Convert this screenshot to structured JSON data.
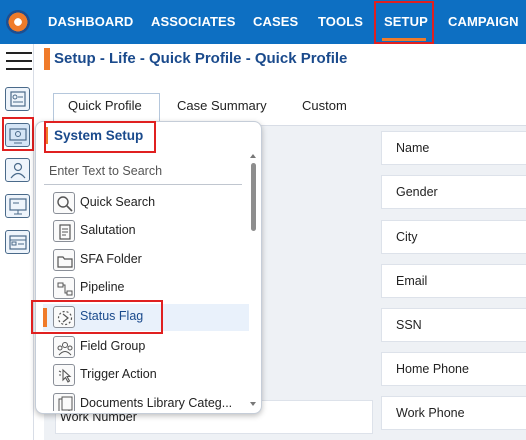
{
  "nav": {
    "items": [
      {
        "label": "DASHBOARD"
      },
      {
        "label": "ASSOCIATES"
      },
      {
        "label": "CASES"
      },
      {
        "label": "TOOLS"
      },
      {
        "label": "SETUP",
        "active": true
      },
      {
        "label": "CAMPAIGN"
      }
    ]
  },
  "page": {
    "breadcrumb": "Setup - Life - Quick Profile - Quick Profile"
  },
  "tabs": [
    {
      "label": "Quick Profile",
      "active": true
    },
    {
      "label": "Case Summary"
    },
    {
      "label": "Custom"
    }
  ],
  "fields_right": [
    {
      "label": "Name"
    },
    {
      "label": "Gender"
    },
    {
      "label": "City"
    },
    {
      "label": "Email"
    },
    {
      "label": "SSN"
    },
    {
      "label": "Home Phone"
    },
    {
      "label": "Work Phone"
    }
  ],
  "fields_left": [
    {
      "label": "Work Number"
    }
  ],
  "popup": {
    "title": "System Setup",
    "search_placeholder": "Enter Text to Search",
    "items": [
      {
        "label": "Quick Search",
        "icon": "magnifier-icon"
      },
      {
        "label": "Salutation",
        "icon": "document-icon"
      },
      {
        "label": "SFA Folder",
        "icon": "folder-icon"
      },
      {
        "label": "Pipeline",
        "icon": "pipeline-icon"
      },
      {
        "label": "Status Flag",
        "icon": "status-flag-icon",
        "selected": true
      },
      {
        "label": "Field Group",
        "icon": "group-icon"
      },
      {
        "label": "Trigger Action",
        "icon": "pointer-icon"
      },
      {
        "label": "Documents Library Categ...",
        "icon": "library-icon"
      }
    ]
  },
  "colors": {
    "nav_bg": "#0d6fc2",
    "accent": "#f07b2a",
    "title_blue": "#1a4a8c",
    "highlight": "#e02020"
  }
}
